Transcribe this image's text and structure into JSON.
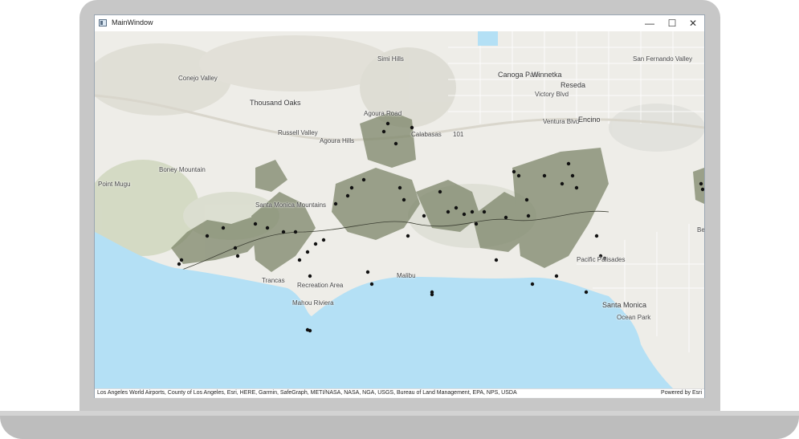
{
  "window": {
    "title": "MainWindow",
    "minimize": "—",
    "maximize": "☐",
    "close": "✕"
  },
  "map": {
    "labels": {
      "simi_hills": "Simi Hills",
      "conejo_valley": "Conejo Valley",
      "thousand_oaks": "Thousand Oaks",
      "agoura_road": "Agoura Road",
      "russell_valley": "Russell Valley",
      "agoura_hills": "Agoura Hills",
      "calabasas": "Calabasas",
      "canoga_park": "Canoga Park",
      "winnetka": "Winnetka",
      "reseda": "Reseda",
      "encino": "Encino",
      "san_fernando_valley": "San Fernando Valley",
      "victory_blvd": "Victory Blvd",
      "ventura_blvd": "Ventura Blvd",
      "boney_mountain": "Boney Mountain",
      "santa_monica_mountains": "Santa Monica Mountains",
      "point_mugu": "Point Mugu",
      "santa_monica": "Santa Monica",
      "ocean_park": "Ocean Park",
      "pacific_palisades": "Pacific Palisades",
      "malibu": "Malibu",
      "mahou_riviera": "Mahou Riviera",
      "recreation_area": "Recreation Area",
      "trancas": "Trancas",
      "route_101": "101",
      "bel_air": "Be"
    },
    "colors": {
      "ocean": "#b4e0f5",
      "land": "#eeede8",
      "parkland": "#7d866a",
      "points": "#111111"
    }
  },
  "attribution": {
    "sources": "Los Angeles World Airports, County of Los Angeles, Esri, HERE, Garmin, SafeGraph, METI/NASA, NASA, NGA, USGS, Bureau of Land Management, EPA, NPS, USDA",
    "powered_by": "Powered by Esri"
  }
}
